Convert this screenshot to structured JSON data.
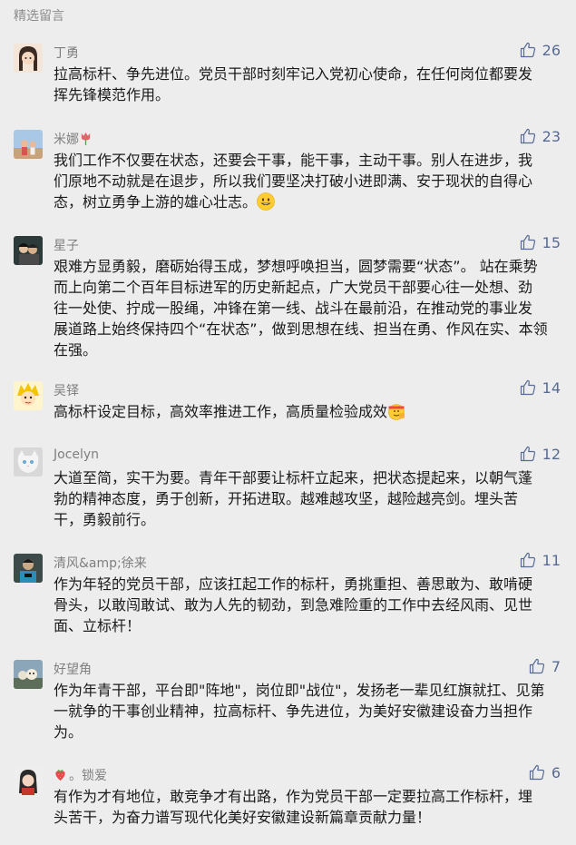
{
  "header": {
    "title": "精选留言"
  },
  "comments": [
    {
      "name": "丁勇",
      "likes": "26",
      "text": "拉高标杆、争先进位。党员干部时刻牢记入党初心使命，在任何岗位都要发\n挥先锋模范作用。"
    },
    {
      "name": "米娜",
      "likes": "23",
      "text": "我们工作不仅要在状态，还要会干事，能干事，主动干事。别人在进步，我\n们原地不动就是在退步，所以我们要坚决打破小进即满、安于现状的自得心\n态，树立勇争上游的雄心壮志。"
    },
    {
      "name": "星子",
      "likes": "15",
      "text": "艰难方显勇毅，磨砺始得玉成，梦想呼唤担当，圆梦需要“状态”。 站在乘势\n而上向第二个百年目标进军的历史新起点，广大党员干部要心往一处想、劲\n往一处使、拧成一股绳，冲锋在第一线、战斗在最前沿，在推动党的事业发\n展道路上始终保持四个“在状态”，做到思想在线、担当在勇、作风在实、本领\n在强。"
    },
    {
      "name": "吴铎",
      "likes": "14",
      "text": "高标杆设定目标，高效率推进工作，高质量检验成效"
    },
    {
      "name": "Jocelyn",
      "likes": "12",
      "text": "大道至简，实干为要。青年干部要让标杆立起来，把状态提起来，以朝气蓬\n勃的精神态度，勇于创新，开拓进取。越难越攻坚，越险越亮剑。埋头苦\n干，勇毅前行。"
    },
    {
      "name": "清风&amp;徐来",
      "likes": "11",
      "text": "作为年轻的党员干部，应该扛起工作的标杆，勇挑重担、善思敢为、敢啃硬\n骨头，以敢闯敢试、敢为人先的韧劲，到急难险重的工作中去经风雨、见世\n面、立标杆！"
    },
    {
      "name": "好望角",
      "likes": "7",
      "text": "作为年青干部，平台即\"阵地\"，岗位即\"战位\"，发扬老一辈见红旗就扛、见第\n一就争的干事创业精神，拉高标杆、争先进位，为美好安徽建设奋力当担作\n为。"
    },
    {
      "name": "。锁爱",
      "likes": "6",
      "text": "有作为才有地位，敢竞争才有出路，作为党员干部一定要拉高工作标杆，埋\n头苦干，为奋力谱写现代化美好安徽建设新篇章贡献力量！"
    }
  ],
  "colors": {
    "background": "#ededed",
    "link": "#576b95",
    "name": "#7f7f7f"
  }
}
